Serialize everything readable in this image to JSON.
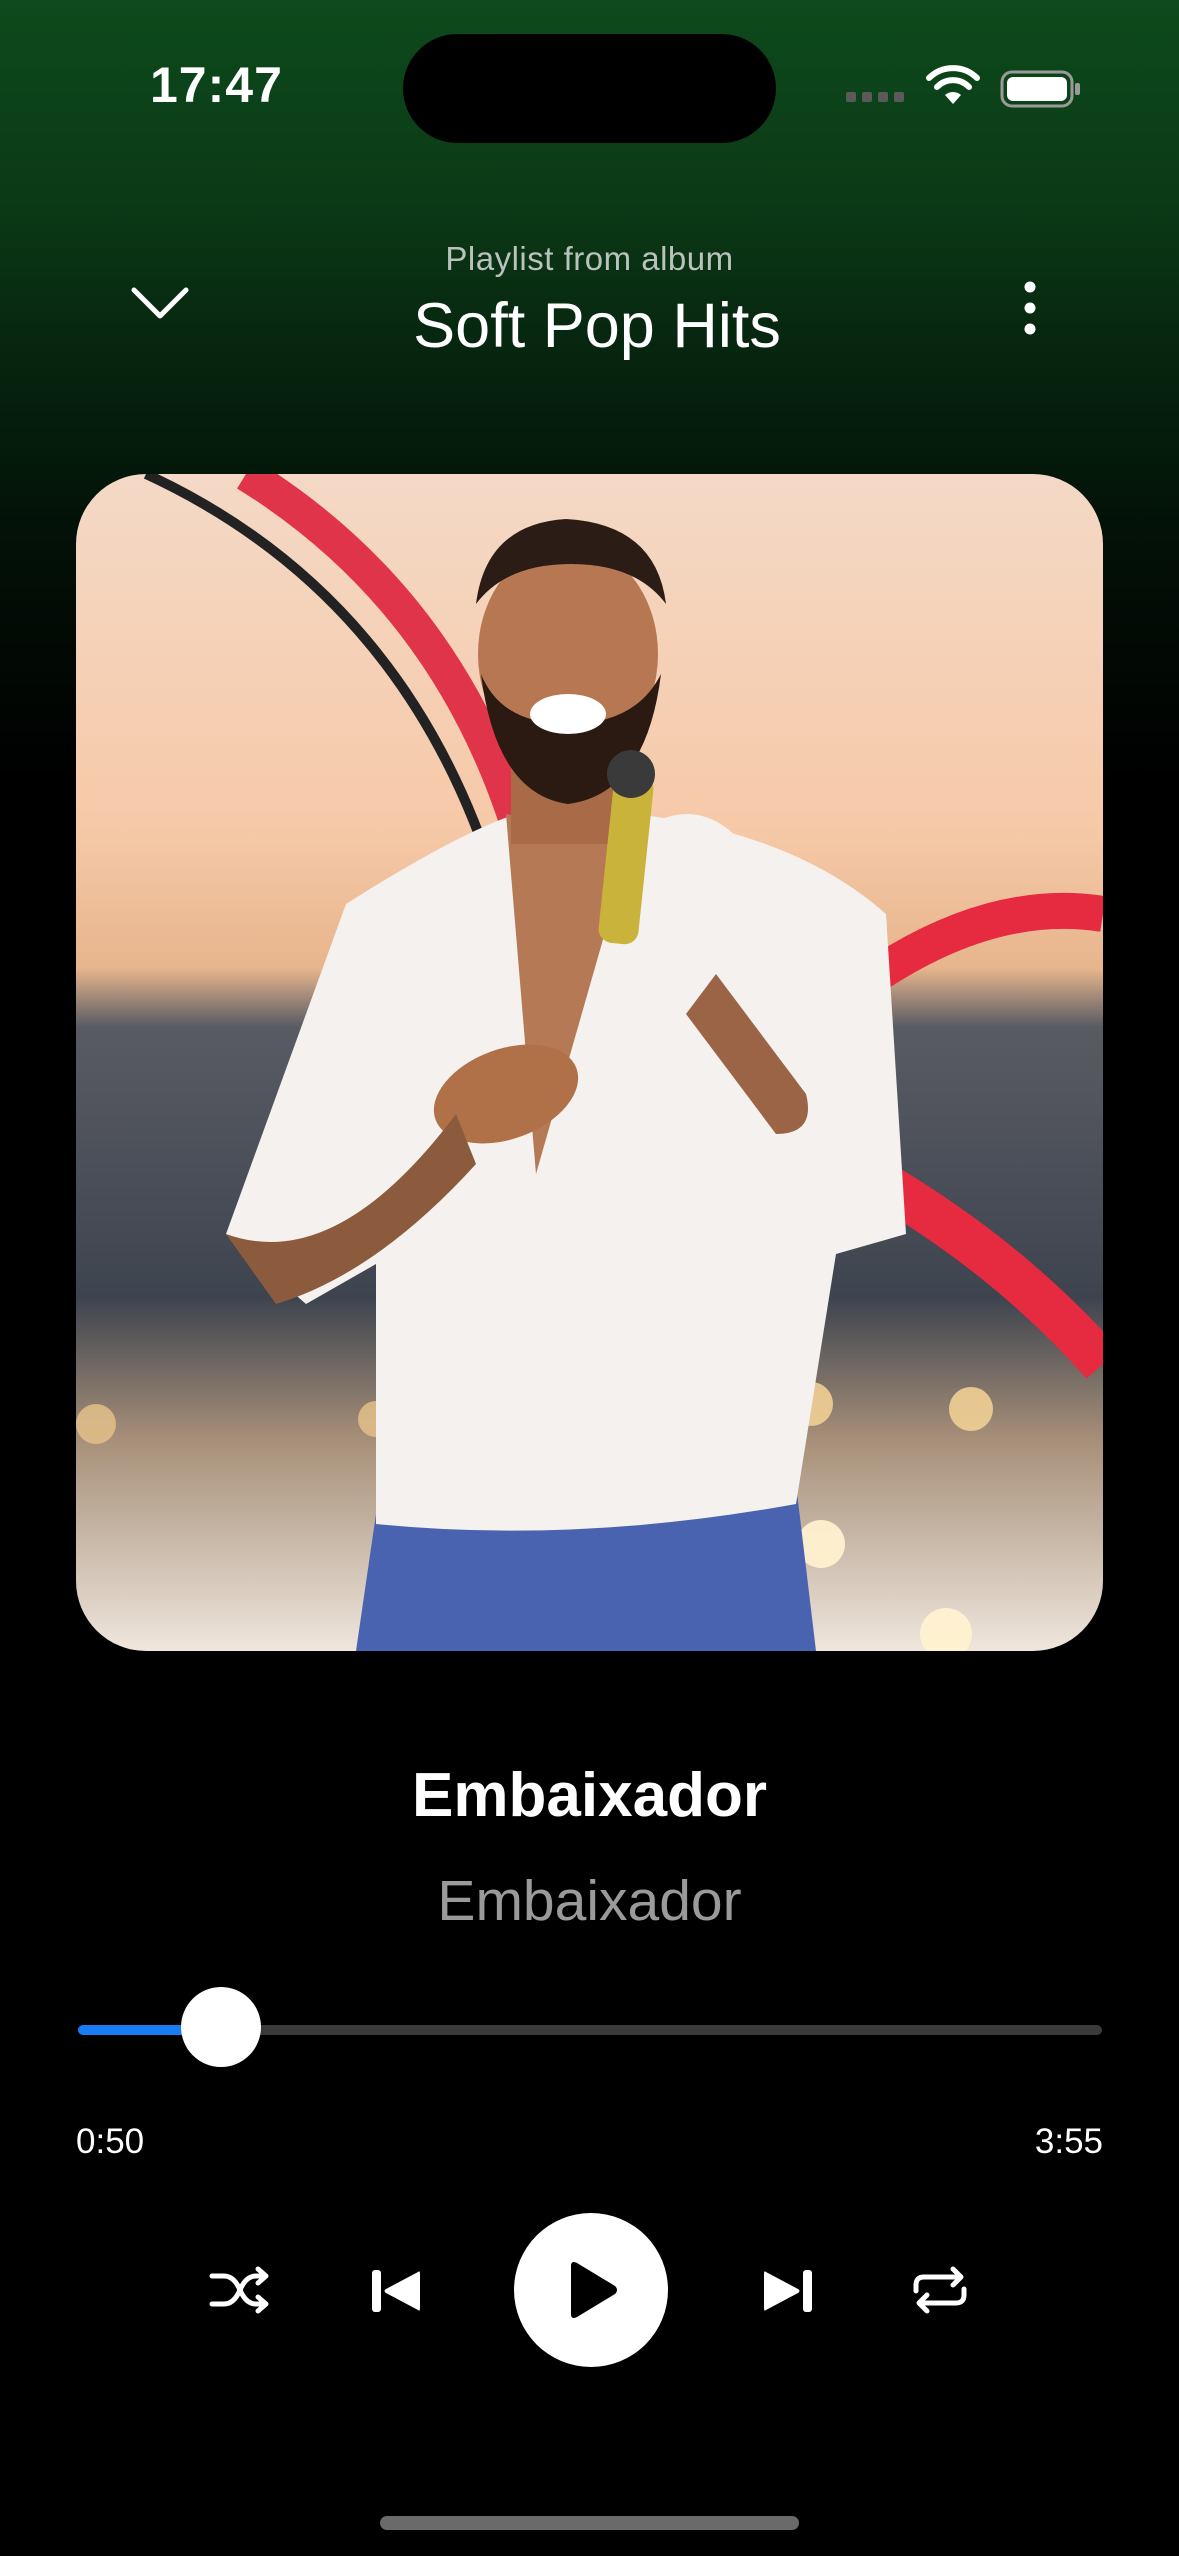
{
  "status_bar": {
    "time": "17:47",
    "icons": [
      "cellular-signal-icon",
      "wifi-icon",
      "battery-icon"
    ]
  },
  "header": {
    "subtitle": "Playlist from album",
    "title": "Soft Pop Hits",
    "left_icon": "chevron-down-icon",
    "right_icon": "more-vertical-icon"
  },
  "track": {
    "title": "Embaixador",
    "artist": "Embaixador"
  },
  "playback": {
    "elapsed": "0:50",
    "total": "3:55",
    "progress_fraction": 0.14,
    "state": "paused"
  },
  "controls": {
    "icons": [
      "shuffle-icon",
      "previous-track-icon",
      "play-icon",
      "next-track-icon",
      "repeat-icon"
    ]
  },
  "colors": {
    "accent": "#1a7cf2",
    "header_gradient_top": "#0d4a1c",
    "background": "#000000"
  }
}
